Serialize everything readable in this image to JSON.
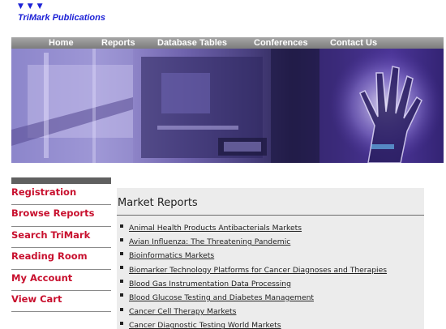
{
  "logo": {
    "mark": "▼ ▼ ▼",
    "text": "TriMark Publications"
  },
  "nav": {
    "items": [
      {
        "label": "Home"
      },
      {
        "label": "Reports"
      },
      {
        "label": "Database Tables"
      },
      {
        "label": "Conferences"
      },
      {
        "label": "Contact Us"
      }
    ]
  },
  "sidebar": {
    "items": [
      {
        "label": "Registration"
      },
      {
        "label": "Browse Reports"
      },
      {
        "label": "Search TriMark"
      },
      {
        "label": "Reading Room"
      },
      {
        "label": "My Account"
      },
      {
        "label": "View Cart"
      }
    ]
  },
  "main": {
    "title": "Market Reports",
    "reports": [
      {
        "label": "Animal Health Products Antibacterials Markets"
      },
      {
        "label": "Avian Influenza: The Threatening Pandemic"
      },
      {
        "label": "Bioinformatics Markets"
      },
      {
        "label": "Biomarker Technology Platforms for Cancer Diagnoses and Therapies"
      },
      {
        "label": "Blood Gas Instrumentation Data Processing"
      },
      {
        "label": "Blood Glucose Testing and Diabetes Management"
      },
      {
        "label": "Cancer Cell Therapy Markets"
      },
      {
        "label": "Cancer Diagnostic Testing World Markets"
      }
    ]
  },
  "colors": {
    "brand_blue": "#1d22d6",
    "sidebar_red": "#c8102e",
    "nav_gray": "#8c8c8c",
    "panel_gray": "#ececec"
  }
}
